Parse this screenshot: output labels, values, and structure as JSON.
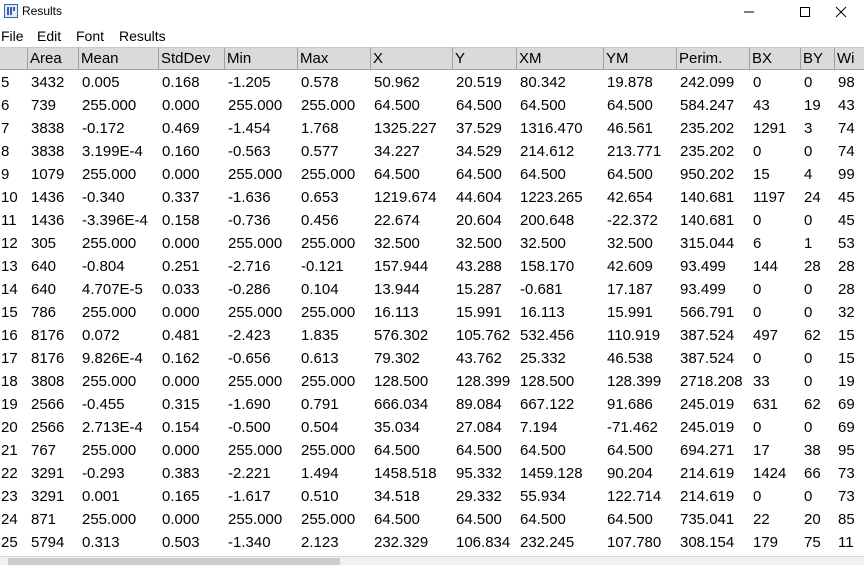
{
  "window": {
    "title": "Results",
    "icon": "imagej-results-icon",
    "controls": [
      "minimize-icon",
      "maximize-icon",
      "close-icon"
    ]
  },
  "menu": [
    "File",
    "Edit",
    "Font",
    "Results"
  ],
  "table": {
    "columns": [
      "",
      "Area",
      "Mean",
      "StdDev",
      "Min",
      "Max",
      "X",
      "Y",
      "XM",
      "YM",
      "Perim.",
      "BX",
      "BY",
      "Wi"
    ],
    "rows": [
      [
        "5",
        "3432",
        "0.005",
        "0.168",
        "-1.205",
        "0.578",
        "50.962",
        "20.519",
        "80.342",
        "19.878",
        "242.099",
        "0",
        "0",
        "98"
      ],
      [
        "6",
        "739",
        "255.000",
        "0.000",
        "255.000",
        "255.000",
        "64.500",
        "64.500",
        "64.500",
        "64.500",
        "584.247",
        "43",
        "19",
        "43"
      ],
      [
        "7",
        "3838",
        "-0.172",
        "0.469",
        "-1.454",
        "1.768",
        "1325.227",
        "37.529",
        "1316.470",
        "46.561",
        "235.202",
        "1291",
        "3",
        "74"
      ],
      [
        "8",
        "3838",
        "3.199E-4",
        "0.160",
        "-0.563",
        "0.577",
        "34.227",
        "34.529",
        "214.612",
        "213.771",
        "235.202",
        "0",
        "0",
        "74"
      ],
      [
        "9",
        "1079",
        "255.000",
        "0.000",
        "255.000",
        "255.000",
        "64.500",
        "64.500",
        "64.500",
        "64.500",
        "950.202",
        "15",
        "4",
        "99"
      ],
      [
        "10",
        "1436",
        "-0.340",
        "0.337",
        "-1.636",
        "0.653",
        "1219.674",
        "44.604",
        "1223.265",
        "42.654",
        "140.681",
        "1197",
        "24",
        "45"
      ],
      [
        "11",
        "1436",
        "-3.396E-4",
        "0.158",
        "-0.736",
        "0.456",
        "22.674",
        "20.604",
        "200.648",
        "-22.372",
        "140.681",
        "0",
        "0",
        "45"
      ],
      [
        "12",
        "305",
        "255.000",
        "0.000",
        "255.000",
        "255.000",
        "32.500",
        "32.500",
        "32.500",
        "32.500",
        "315.044",
        "6",
        "1",
        "53"
      ],
      [
        "13",
        "640",
        "-0.804",
        "0.251",
        "-2.716",
        "-0.121",
        "157.944",
        "43.288",
        "158.170",
        "42.609",
        "93.499",
        "144",
        "28",
        "28"
      ],
      [
        "14",
        "640",
        "4.707E-5",
        "0.033",
        "-0.286",
        "0.104",
        "13.944",
        "15.287",
        "-0.681",
        "17.187",
        "93.499",
        "0",
        "0",
        "28"
      ],
      [
        "15",
        "786",
        "255.000",
        "0.000",
        "255.000",
        "255.000",
        "16.113",
        "15.991",
        "16.113",
        "15.991",
        "566.791",
        "0",
        "0",
        "32"
      ],
      [
        "16",
        "8176",
        "0.072",
        "0.481",
        "-2.423",
        "1.835",
        "576.302",
        "105.762",
        "532.456",
        "110.919",
        "387.524",
        "497",
        "62",
        "15"
      ],
      [
        "17",
        "8176",
        "9.826E-4",
        "0.162",
        "-0.656",
        "0.613",
        "79.302",
        "43.762",
        "25.332",
        "46.538",
        "387.524",
        "0",
        "0",
        "15"
      ],
      [
        "18",
        "3808",
        "255.000",
        "0.000",
        "255.000",
        "255.000",
        "128.500",
        "128.399",
        "128.500",
        "128.399",
        "2718.208",
        "33",
        "0",
        "19"
      ],
      [
        "19",
        "2566",
        "-0.455",
        "0.315",
        "-1.690",
        "0.791",
        "666.034",
        "89.084",
        "667.122",
        "91.686",
        "245.019",
        "631",
        "62",
        "69"
      ],
      [
        "20",
        "2566",
        "2.713E-4",
        "0.154",
        "-0.500",
        "0.504",
        "35.034",
        "27.084",
        "7.194",
        "-71.462",
        "245.019",
        "0",
        "0",
        "69"
      ],
      [
        "21",
        "767",
        "255.000",
        "0.000",
        "255.000",
        "255.000",
        "64.500",
        "64.500",
        "64.500",
        "64.500",
        "694.271",
        "17",
        "38",
        "95"
      ],
      [
        "22",
        "3291",
        "-0.293",
        "0.383",
        "-2.221",
        "1.494",
        "1458.518",
        "95.332",
        "1459.128",
        "90.204",
        "214.619",
        "1424",
        "66",
        "73"
      ],
      [
        "23",
        "3291",
        "0.001",
        "0.165",
        "-1.617",
        "0.510",
        "34.518",
        "29.332",
        "55.934",
        "122.714",
        "214.619",
        "0",
        "0",
        "73"
      ],
      [
        "24",
        "871",
        "255.000",
        "0.000",
        "255.000",
        "255.000",
        "64.500",
        "64.500",
        "64.500",
        "64.500",
        "735.041",
        "22",
        "20",
        "85"
      ],
      [
        "25",
        "5794",
        "0.313",
        "0.503",
        "-1.340",
        "2.123",
        "232.329",
        "106.834",
        "232.245",
        "107.780",
        "308.154",
        "179",
        "75",
        "11"
      ]
    ]
  },
  "colors": {
    "header_bg": "#dadada",
    "window_bg": "#ffffff"
  }
}
